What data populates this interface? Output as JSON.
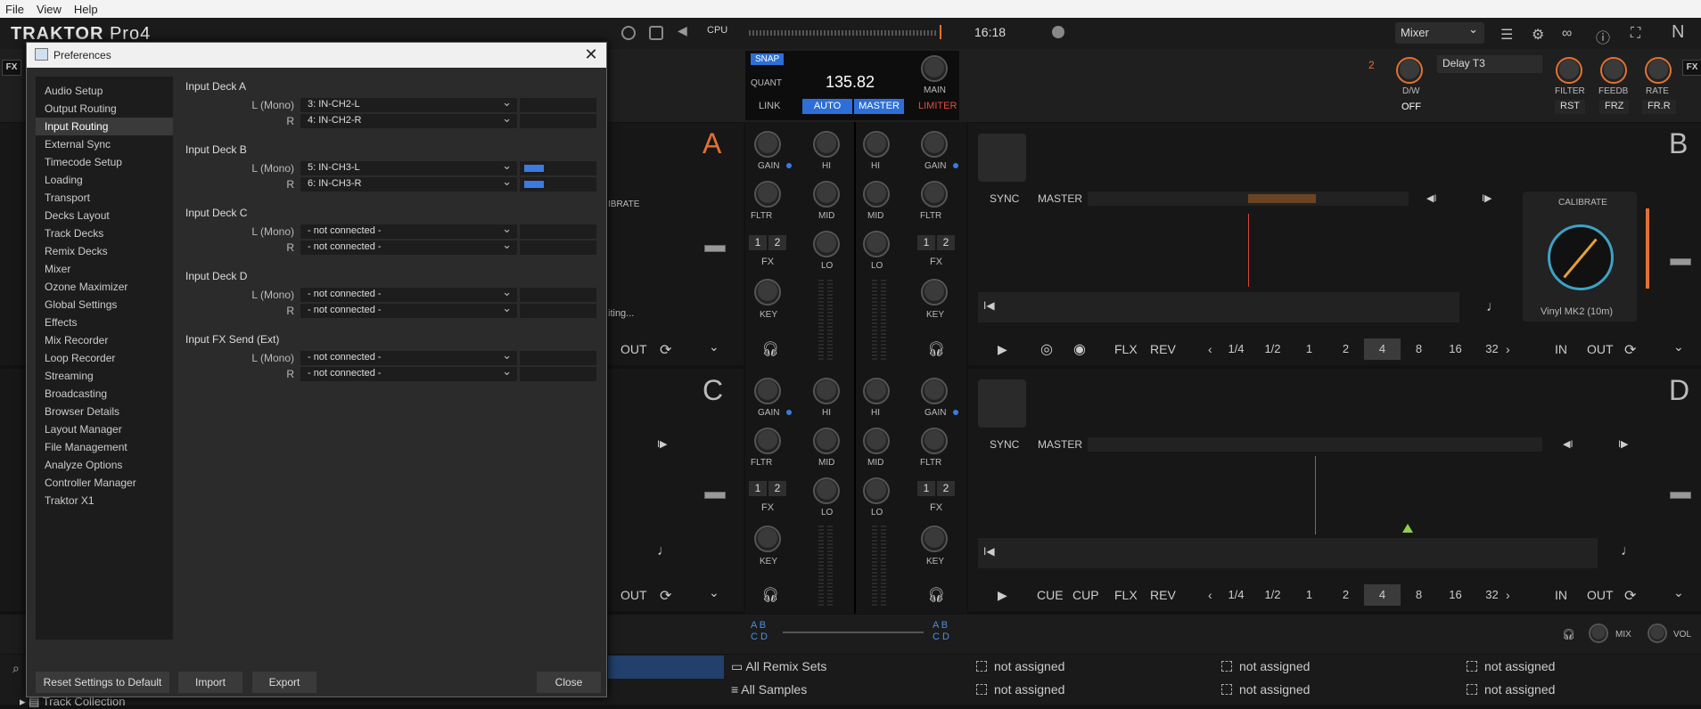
{
  "menubar": {
    "file": "File",
    "view": "View",
    "help": "Help"
  },
  "header": {
    "brand": "TRAKTOR",
    "product": "Pro",
    "version": "4",
    "cpu_label": "CPU",
    "time": "16:18",
    "layout": "Mixer"
  },
  "master": {
    "snap": "SNAP",
    "quant": "QUANT",
    "bpm": "135.82",
    "link": "LINK",
    "auto": "AUTO",
    "master": "MASTER",
    "main": "MAIN",
    "limiter": "LIMITER"
  },
  "fx_unit": {
    "number": "2",
    "effect": "Delay T3",
    "dw": "D/W",
    "dw_state": "OFF",
    "knobs": [
      {
        "label": "FILTER",
        "btn": "RST"
      },
      {
        "label": "FEEDB",
        "btn": "FRZ"
      },
      {
        "label": "RATE",
        "btn": "FR.R"
      }
    ],
    "fx_tag": "FX"
  },
  "decks": {
    "a": {
      "letter": "A",
      "partial_calibrate": "IBRATE",
      "partial_waiting": "iting...",
      "out": "OUT"
    },
    "b": {
      "letter": "B",
      "sync": "SYNC",
      "master": "MASTER",
      "calibrate": "CALIBRATE",
      "vinyl": "Vinyl MK2 (10m)",
      "flx": "FLX",
      "rev": "REV",
      "in": "IN",
      "out": "OUT",
      "beats": [
        "1/4",
        "1/2",
        "1",
        "2",
        "4",
        "8",
        "16",
        "32"
      ],
      "selected_beat": "4"
    },
    "c": {
      "letter": "C",
      "out": "OUT"
    },
    "d": {
      "letter": "D",
      "sync": "SYNC",
      "master": "MASTER",
      "cue": "CUE",
      "cup": "CUP",
      "flx": "FLX",
      "rev": "REV",
      "in": "IN",
      "out": "OUT",
      "beats": [
        "1/4",
        "1/2",
        "1",
        "2",
        "4",
        "8",
        "16",
        "32"
      ],
      "selected_beat": "4"
    }
  },
  "mixer": {
    "gain": "GAIN",
    "hi": "HI",
    "mid": "MID",
    "lo": "LO",
    "fltr": "FLTR",
    "fx": "FX",
    "key": "KEY",
    "one": "1",
    "two": "2",
    "xfader_left": "A B\nC D",
    "xfader_right": "A B\nC D",
    "mix": "MIX",
    "vol": "VOL"
  },
  "browser": {
    "rows": [
      [
        "All Remix Sets",
        "not assigned",
        "not assigned",
        "not assigned"
      ],
      [
        "All Samples",
        "not assigned",
        "not assigned",
        "not assigned"
      ]
    ],
    "collection": "Track Collection"
  },
  "dialog": {
    "title": "Preferences",
    "nav": [
      "Audio Setup",
      "Output Routing",
      "Input Routing",
      "External Sync",
      "Timecode Setup",
      "Loading",
      "Transport",
      "Decks Layout",
      "Track Decks",
      "Remix Decks",
      "Mixer",
      "Ozone Maximizer",
      "Global Settings",
      "Effects",
      "Mix Recorder",
      "Loop Recorder",
      "Streaming",
      "Broadcasting",
      "Browser Details",
      "Layout Manager",
      "File Management",
      "Analyze Options",
      "Controller Manager",
      "Traktor X1"
    ],
    "active_nav": "Input Routing",
    "sections": [
      {
        "title": "Input Deck A",
        "rows": [
          {
            "label": "L (Mono)",
            "value": "3: IN-CH2-L"
          },
          {
            "label": "R",
            "value": "4: IN-CH2-R"
          }
        ]
      },
      {
        "title": "Input Deck B",
        "rows": [
          {
            "label": "L (Mono)",
            "value": "5: IN-CH3-L"
          },
          {
            "label": "R",
            "value": "6: IN-CH3-R"
          }
        ]
      },
      {
        "title": "Input Deck C",
        "rows": [
          {
            "label": "L (Mono)",
            "value": "- not connected -"
          },
          {
            "label": "R",
            "value": "- not connected -"
          }
        ]
      },
      {
        "title": "Input Deck D",
        "rows": [
          {
            "label": "L (Mono)",
            "value": "- not connected -"
          },
          {
            "label": "R",
            "value": "- not connected -"
          }
        ]
      },
      {
        "title": "Input FX Send (Ext)",
        "rows": [
          {
            "label": "L (Mono)",
            "value": "- not connected -"
          },
          {
            "label": "R",
            "value": "- not connected -"
          }
        ]
      }
    ],
    "buttons": {
      "reset": "Reset Settings to Default",
      "import": "Import",
      "export": "Export",
      "close": "Close"
    }
  },
  "colors": {
    "accent_blue": "#2d6fd6",
    "deck_orange": "#e27133",
    "limiter_red": "#e0503c"
  }
}
